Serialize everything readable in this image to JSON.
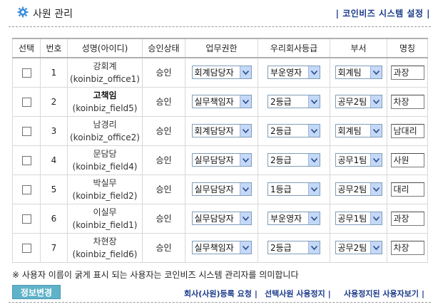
{
  "header": {
    "title": "사원 관리",
    "system_link": "코인비즈 시스템 설정"
  },
  "table": {
    "headers": [
      "선택",
      "번호",
      "성명(아이디)",
      "승인상태",
      "업무권한",
      "우리회사등급",
      "부서",
      "명칭"
    ],
    "rows": [
      {
        "no": "1",
        "name": "강회계",
        "id": "(koinbiz_office1)",
        "bold": false,
        "status": "승인",
        "role": "회계담당자",
        "grade": "부운영자",
        "dept": "회계팀",
        "position": "과장"
      },
      {
        "no": "2",
        "name": "고책임",
        "id": "(koinbiz_field5)",
        "bold": true,
        "status": "승인",
        "role": "실무책임자",
        "grade": "2등급",
        "dept": "공무2팀",
        "position": "차장"
      },
      {
        "no": "3",
        "name": "남경리",
        "id": "(koinbiz_office2)",
        "bold": false,
        "status": "승인",
        "role": "회계담당자",
        "grade": "2등급",
        "dept": "회계팀",
        "position": "남대리"
      },
      {
        "no": "4",
        "name": "문담당",
        "id": "(koinbiz_field4)",
        "bold": false,
        "status": "승인",
        "role": "실무담당자",
        "grade": "2등급",
        "dept": "공무1팀",
        "position": "사원"
      },
      {
        "no": "5",
        "name": "박실무",
        "id": "(koinbiz_field2)",
        "bold": false,
        "status": "승인",
        "role": "실무담당자",
        "grade": "1등급",
        "dept": "공무2팀",
        "position": "대리"
      },
      {
        "no": "6",
        "name": "이실무",
        "id": "(koinbiz_field1)",
        "bold": false,
        "status": "승인",
        "role": "실무담당자",
        "grade": "부운영자",
        "dept": "공무1팀",
        "position": "과장"
      },
      {
        "no": "7",
        "name": "차현장",
        "id": "(koinbiz_field6)",
        "bold": false,
        "status": "승인",
        "role": "실무책임자",
        "grade": "2등급",
        "dept": "공무2팀",
        "position": "차장"
      }
    ]
  },
  "note": "※ 사용자 이름이 굵게 표시 되는 사용자는 코인비즈 시스템 관리자를 의미합니다",
  "buttons": {
    "info_change": "정보변경",
    "register_request": "회사(사원)등록 요청",
    "suspend_selected": "선택사원 사용정지",
    "view_suspended": "사용정지된 사용자보기"
  },
  "colors": {
    "link": "#1a3a8a",
    "info_button": "#5fb3c9",
    "select_arrow": "#c4d8f7"
  }
}
